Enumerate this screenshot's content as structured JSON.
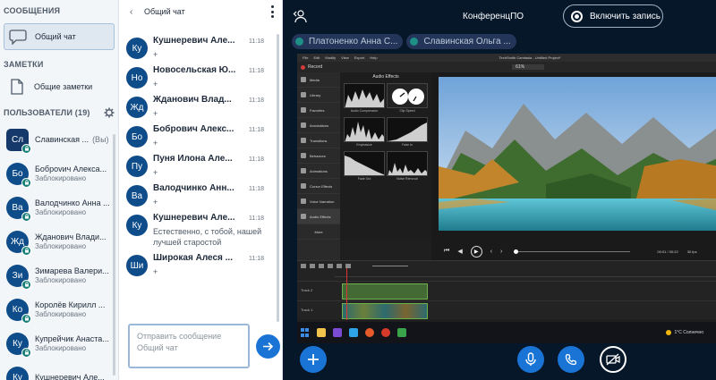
{
  "sidebar": {
    "messages_heading": "СООБЩЕНИЯ",
    "general_chat": "Общий чат",
    "notes_heading": "ЗАМЕТКИ",
    "shared_notes": "Общие заметки",
    "users_heading": "ПОЛЬЗОВАТЕЛИ (19)",
    "users": [
      {
        "initials": "Сл",
        "name": "Славинская ...",
        "you": "(Вы)",
        "status": ""
      },
      {
        "initials": "Бо",
        "name": "Боброvич Алекса...",
        "status": "Заблокировано"
      },
      {
        "initials": "Ва",
        "name": "Валодчинко Анна ...",
        "status": "Заблокировано"
      },
      {
        "initials": "Жд",
        "name": "Жданович Влади...",
        "status": "Заблокировано"
      },
      {
        "initials": "Зи",
        "name": "Зимарева Валери...",
        "status": "Заблокировано"
      },
      {
        "initials": "Ко",
        "name": "Королёв Кирилл ...",
        "status": "Заблокировано"
      },
      {
        "initials": "Ку",
        "name": "Купрейчик Анаста...",
        "status": "Заблокировано"
      },
      {
        "initials": "Ку",
        "name": "Кушнеревич Але...",
        "status": ""
      }
    ]
  },
  "chat": {
    "back_arrow": "‹",
    "title": "Общий чат",
    "messages": [
      {
        "initials": "Ку",
        "name": "Кушнеревич Але...",
        "time": "11:18",
        "text": "+"
      },
      {
        "initials": "Но",
        "name": "Новосельская Ю...",
        "time": "11:18",
        "text": "+"
      },
      {
        "initials": "Жд",
        "name": "Жданович Влад...",
        "time": "11:18",
        "text": "+"
      },
      {
        "initials": "Бо",
        "name": "Бобрович Алекс...",
        "time": "11:18",
        "text": "+"
      },
      {
        "initials": "Пу",
        "name": "Пуня Илона Але...",
        "time": "11:18",
        "text": "+"
      },
      {
        "initials": "Ва",
        "name": "Валодчинко Анн...",
        "time": "11:18",
        "text": "+"
      },
      {
        "initials": "Ку",
        "name": "Кушнеревич Але...",
        "time": "11:18",
        "text": "Естественно, с тобой, нашей лучшей старостой"
      },
      {
        "initials": "Ши",
        "name": "Широкая Алеся ...",
        "time": "11:18",
        "text": "+"
      }
    ],
    "composer_placeholder": "Отправить сообщение Общий чат"
  },
  "conference": {
    "title": "КонференцПО",
    "record_label": "Включить запись",
    "presenters": [
      "Платоненко Анна С...",
      "Славинская Ольга ..."
    ]
  },
  "screen_share": {
    "window_title": "TechSmith Camtasia - Untitled Project*",
    "menu": [
      "File",
      "Edit",
      "Modify",
      "View",
      "Export",
      "Help"
    ],
    "record_label": "Record",
    "zoom": "61%",
    "tools": [
      "Media",
      "Library",
      "Favorites",
      "Annotations",
      "Transitions",
      "Behaviors",
      "Animations",
      "Cursor Effects",
      "Voice Narration",
      "Audio Effects"
    ],
    "more_label": "More",
    "panel_title": "Audio Effects",
    "effects": [
      "Audio Compression",
      "Clip Speed",
      "Emphasize",
      "Fade In",
      "Fade Out",
      "Noise Removal"
    ],
    "time_readout": "00:01 / 00:22",
    "fps": "30 fps",
    "tracks": [
      "Track 2",
      "Track 1"
    ],
    "weather": "1°C Солнечно"
  },
  "colors": {
    "accent": "#1a74d6",
    "dark_bg": "#06172a",
    "lock_badge": "#177f77"
  }
}
